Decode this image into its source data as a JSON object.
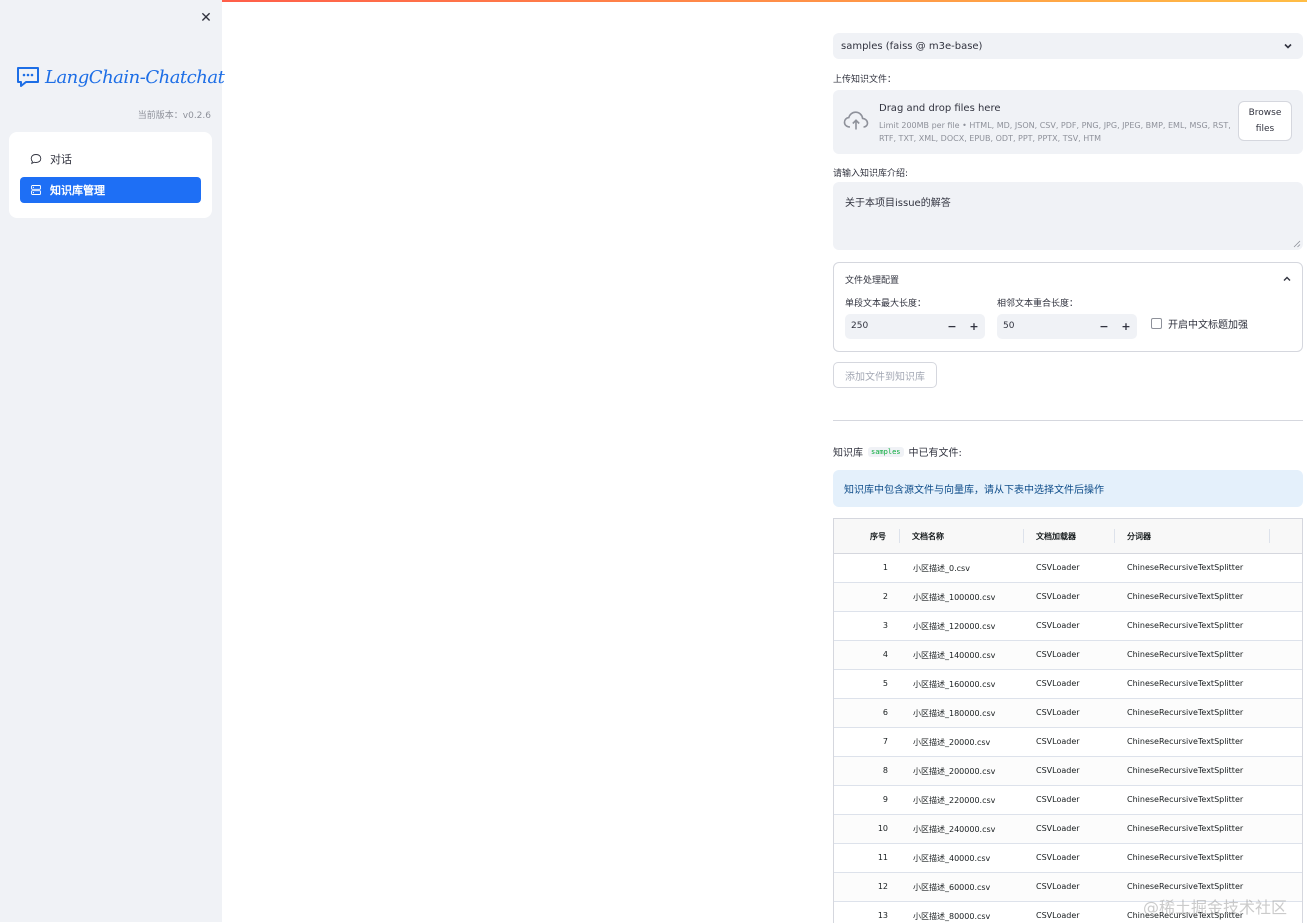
{
  "sidebar": {
    "app_name": "LangChain-Chatchat",
    "version": "当前版本：v0.2.6",
    "menu": [
      {
        "label": "对话",
        "icon": "chat-bubble-icon",
        "active": false
      },
      {
        "label": "知识库管理",
        "icon": "database-icon",
        "active": true
      }
    ],
    "accent": "#1e6ff5"
  },
  "main": {
    "kb_select": {
      "value": "samples (faiss @ m3e-base)"
    },
    "upload": {
      "label": "上传知识文件：",
      "drag_title": "Drag and drop files here",
      "limit": "Limit 200MB per file • HTML, MD, JSON, CSV, PDF, PNG, JPG, JPEG, BMP, EML, MSG, RST, RTF, TXT, XML, DOCX, EPUB, ODT, PPT, PPTX, TSV, HTM",
      "browse_label": "Browse files"
    },
    "intro": {
      "label": "请输入知识库介绍:",
      "value": "关于本项目issue的解答"
    },
    "file_config": {
      "title": "文件处理配置",
      "chunk_size_label": "单段文本最大长度：",
      "chunk_size": "250",
      "overlap_label": "相邻文本重合长度：",
      "overlap": "50",
      "zh_title_label": "开启中文标题加强"
    },
    "add_button": "添加文件到知识库",
    "kb_files": {
      "prefix": "知识库",
      "kb_name": "samples",
      "suffix": "中已有文件:"
    },
    "info": "知识库中包含源文件与向量库，请从下表中选择文件后操作"
  },
  "table": {
    "headers": {
      "idx": "序号",
      "name": "文档名称",
      "loader": "文档加载器",
      "splitter": "分词器"
    },
    "rows": [
      {
        "idx": "1",
        "name": "小区描述_0.csv",
        "loader": "CSVLoader",
        "splitter": "ChineseRecursiveTextSplitter"
      },
      {
        "idx": "2",
        "name": "小区描述_100000.csv",
        "loader": "CSVLoader",
        "splitter": "ChineseRecursiveTextSplitter"
      },
      {
        "idx": "3",
        "name": "小区描述_120000.csv",
        "loader": "CSVLoader",
        "splitter": "ChineseRecursiveTextSplitter"
      },
      {
        "idx": "4",
        "name": "小区描述_140000.csv",
        "loader": "CSVLoader",
        "splitter": "ChineseRecursiveTextSplitter"
      },
      {
        "idx": "5",
        "name": "小区描述_160000.csv",
        "loader": "CSVLoader",
        "splitter": "ChineseRecursiveTextSplitter"
      },
      {
        "idx": "6",
        "name": "小区描述_180000.csv",
        "loader": "CSVLoader",
        "splitter": "ChineseRecursiveTextSplitter"
      },
      {
        "idx": "7",
        "name": "小区描述_20000.csv",
        "loader": "CSVLoader",
        "splitter": "ChineseRecursiveTextSplitter"
      },
      {
        "idx": "8",
        "name": "小区描述_200000.csv",
        "loader": "CSVLoader",
        "splitter": "ChineseRecursiveTextSplitter"
      },
      {
        "idx": "9",
        "name": "小区描述_220000.csv",
        "loader": "CSVLoader",
        "splitter": "ChineseRecursiveTextSplitter"
      },
      {
        "idx": "10",
        "name": "小区描述_240000.csv",
        "loader": "CSVLoader",
        "splitter": "ChineseRecursiveTextSplitter"
      },
      {
        "idx": "11",
        "name": "小区描述_40000.csv",
        "loader": "CSVLoader",
        "splitter": "ChineseRecursiveTextSplitter"
      },
      {
        "idx": "12",
        "name": "小区描述_60000.csv",
        "loader": "CSVLoader",
        "splitter": "ChineseRecursiveTextSplitter"
      },
      {
        "idx": "13",
        "name": "小区描述_80000.csv",
        "loader": "CSVLoader",
        "splitter": "ChineseRecursiveTextSplitter"
      }
    ]
  },
  "watermark": "@稀土掘金技术社区"
}
